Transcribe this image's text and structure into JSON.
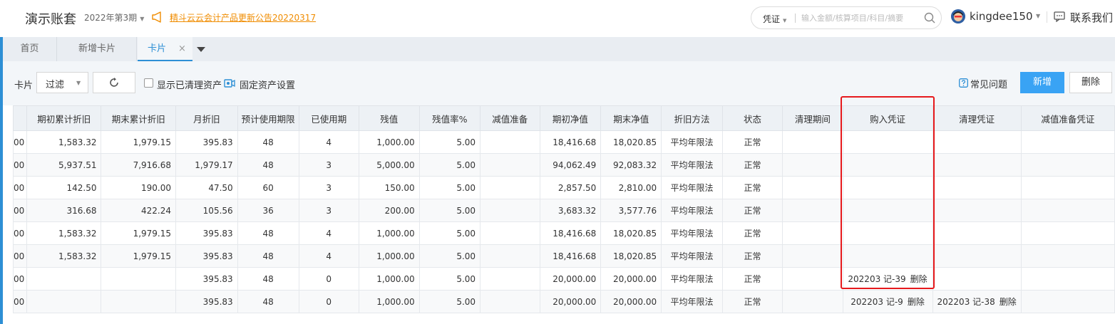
{
  "header": {
    "app_title": "演示账套",
    "period": "2022年第3期",
    "notice": "精斗云云会计产品更新公告20220317",
    "search": {
      "type": "凭证",
      "placeholder": "输入金额/核算项目/科目/摘要"
    },
    "username": "kingdee150",
    "contact": "联系我们"
  },
  "tabs": {
    "home": "首页",
    "add_card": "新增卡片",
    "card": "卡片",
    "close": "×"
  },
  "toolbar": {
    "card_label": "卡片",
    "filter": "过滤",
    "show_cleared": "显示已清理资产",
    "asset_settings": "固定资产设置",
    "faq": "常见问题",
    "new": "新增",
    "delete": "删除"
  },
  "table": {
    "columns": [
      "",
      "期初累计折旧",
      "期末累计折旧",
      "月折旧",
      "预计使用期限",
      "已使用期",
      "残值",
      "残值率%",
      "减值准备",
      "期初净值",
      "期末净值",
      "折旧方法",
      "状态",
      "清理期间",
      "购入凭证",
      "清理凭证",
      "减值准备凭证"
    ],
    "rows": [
      {
        "lead": "00",
        "open_dep": "1,583.32",
        "close_dep": "1,979.15",
        "monthly": "395.83",
        "life": "48",
        "used": "4",
        "residual": "1,000.00",
        "rate": "5.00",
        "impair": "",
        "open_net": "18,416.68",
        "close_net": "18,020.85",
        "method": "平均年限法",
        "status": "正常",
        "clear_period": "",
        "purchase_v": "",
        "purchase_del": "",
        "clear_v": "",
        "clear_del": "",
        "impair_v": ""
      },
      {
        "lead": "00",
        "open_dep": "5,937.51",
        "close_dep": "7,916.68",
        "monthly": "1,979.17",
        "life": "48",
        "used": "3",
        "residual": "5,000.00",
        "rate": "5.00",
        "impair": "",
        "open_net": "94,062.49",
        "close_net": "92,083.32",
        "method": "平均年限法",
        "status": "正常",
        "clear_period": "",
        "purchase_v": "",
        "purchase_del": "",
        "clear_v": "",
        "clear_del": "",
        "impair_v": ""
      },
      {
        "lead": "00",
        "open_dep": "142.50",
        "close_dep": "190.00",
        "monthly": "47.50",
        "life": "60",
        "used": "3",
        "residual": "150.00",
        "rate": "5.00",
        "impair": "",
        "open_net": "2,857.50",
        "close_net": "2,810.00",
        "method": "平均年限法",
        "status": "正常",
        "clear_period": "",
        "purchase_v": "",
        "purchase_del": "",
        "clear_v": "",
        "clear_del": "",
        "impair_v": ""
      },
      {
        "lead": "00",
        "open_dep": "316.68",
        "close_dep": "422.24",
        "monthly": "105.56",
        "life": "36",
        "used": "3",
        "residual": "200.00",
        "rate": "5.00",
        "impair": "",
        "open_net": "3,683.32",
        "close_net": "3,577.76",
        "method": "平均年限法",
        "status": "正常",
        "clear_period": "",
        "purchase_v": "",
        "purchase_del": "",
        "clear_v": "",
        "clear_del": "",
        "impair_v": ""
      },
      {
        "lead": "00",
        "open_dep": "1,583.32",
        "close_dep": "1,979.15",
        "monthly": "395.83",
        "life": "48",
        "used": "4",
        "residual": "1,000.00",
        "rate": "5.00",
        "impair": "",
        "open_net": "18,416.68",
        "close_net": "18,020.85",
        "method": "平均年限法",
        "status": "正常",
        "clear_period": "",
        "purchase_v": "",
        "purchase_del": "",
        "clear_v": "",
        "clear_del": "",
        "impair_v": ""
      },
      {
        "lead": "00",
        "open_dep": "1,583.32",
        "close_dep": "1,979.15",
        "monthly": "395.83",
        "life": "48",
        "used": "4",
        "residual": "1,000.00",
        "rate": "5.00",
        "impair": "",
        "open_net": "18,416.68",
        "close_net": "18,020.85",
        "method": "平均年限法",
        "status": "正常",
        "clear_period": "",
        "purchase_v": "",
        "purchase_del": "",
        "clear_v": "",
        "clear_del": "",
        "impair_v": ""
      },
      {
        "lead": "00",
        "open_dep": "",
        "close_dep": "",
        "monthly": "395.83",
        "life": "48",
        "used": "0",
        "residual": "1,000.00",
        "rate": "5.00",
        "impair": "",
        "open_net": "20,000.00",
        "close_net": "20,000.00",
        "method": "平均年限法",
        "status": "正常",
        "clear_period": "",
        "purchase_v": "202203 记-39",
        "purchase_del": "删除",
        "clear_v": "",
        "clear_del": "",
        "impair_v": ""
      },
      {
        "lead": "00",
        "open_dep": "",
        "close_dep": "",
        "monthly": "395.83",
        "life": "48",
        "used": "0",
        "residual": "1,000.00",
        "rate": "5.00",
        "impair": "",
        "open_net": "20,000.00",
        "close_net": "20,000.00",
        "method": "平均年限法",
        "status": "正常",
        "clear_period": "",
        "purchase_v": "202203 记-9",
        "purchase_del": "删除",
        "clear_v": "202203 记-38",
        "clear_del": "删除",
        "impair_v": ""
      }
    ]
  },
  "colors": {
    "accent": "#2d8fd5",
    "primary_button": "#39a3f4",
    "notice": "#f08c00",
    "highlight": "#e6191c"
  }
}
